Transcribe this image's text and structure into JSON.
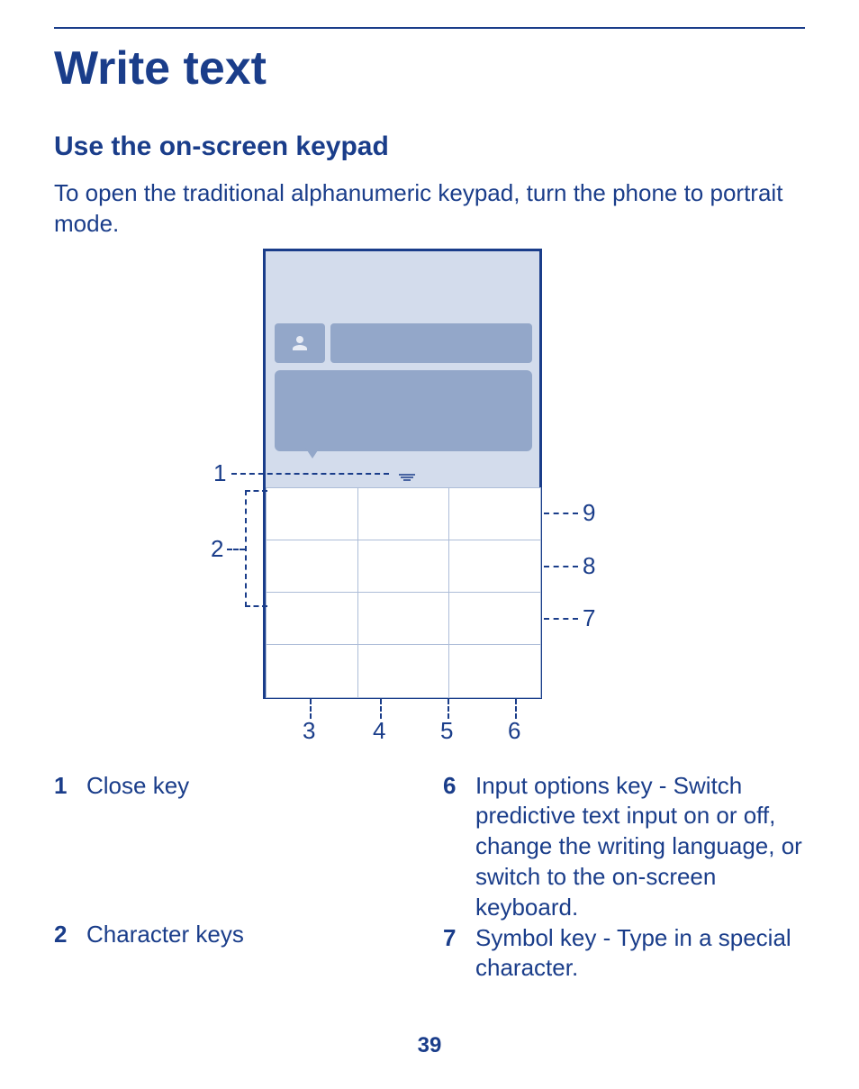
{
  "title": "Write text",
  "subtitle": "Use the on-screen keypad",
  "intro": "To open the traditional alphanumeric keypad, turn the phone to portrait mode.",
  "callouts": {
    "c1": "1",
    "c2": "2",
    "c3": "3",
    "c4": "4",
    "c5": "5",
    "c6": "6",
    "c7": "7",
    "c8": "8",
    "c9": "9"
  },
  "legend": {
    "left": [
      {
        "num": "1",
        "text": "Close key"
      },
      {
        "num": "2",
        "text": "Character keys"
      }
    ],
    "right": [
      {
        "num": "6",
        "text": "Input options key - Switch predictive text input on or off, change the writing language, or switch to the on-screen keyboard."
      },
      {
        "num": "7",
        "text": "Symbol key - Type in a special character."
      }
    ]
  },
  "page_number": "39"
}
